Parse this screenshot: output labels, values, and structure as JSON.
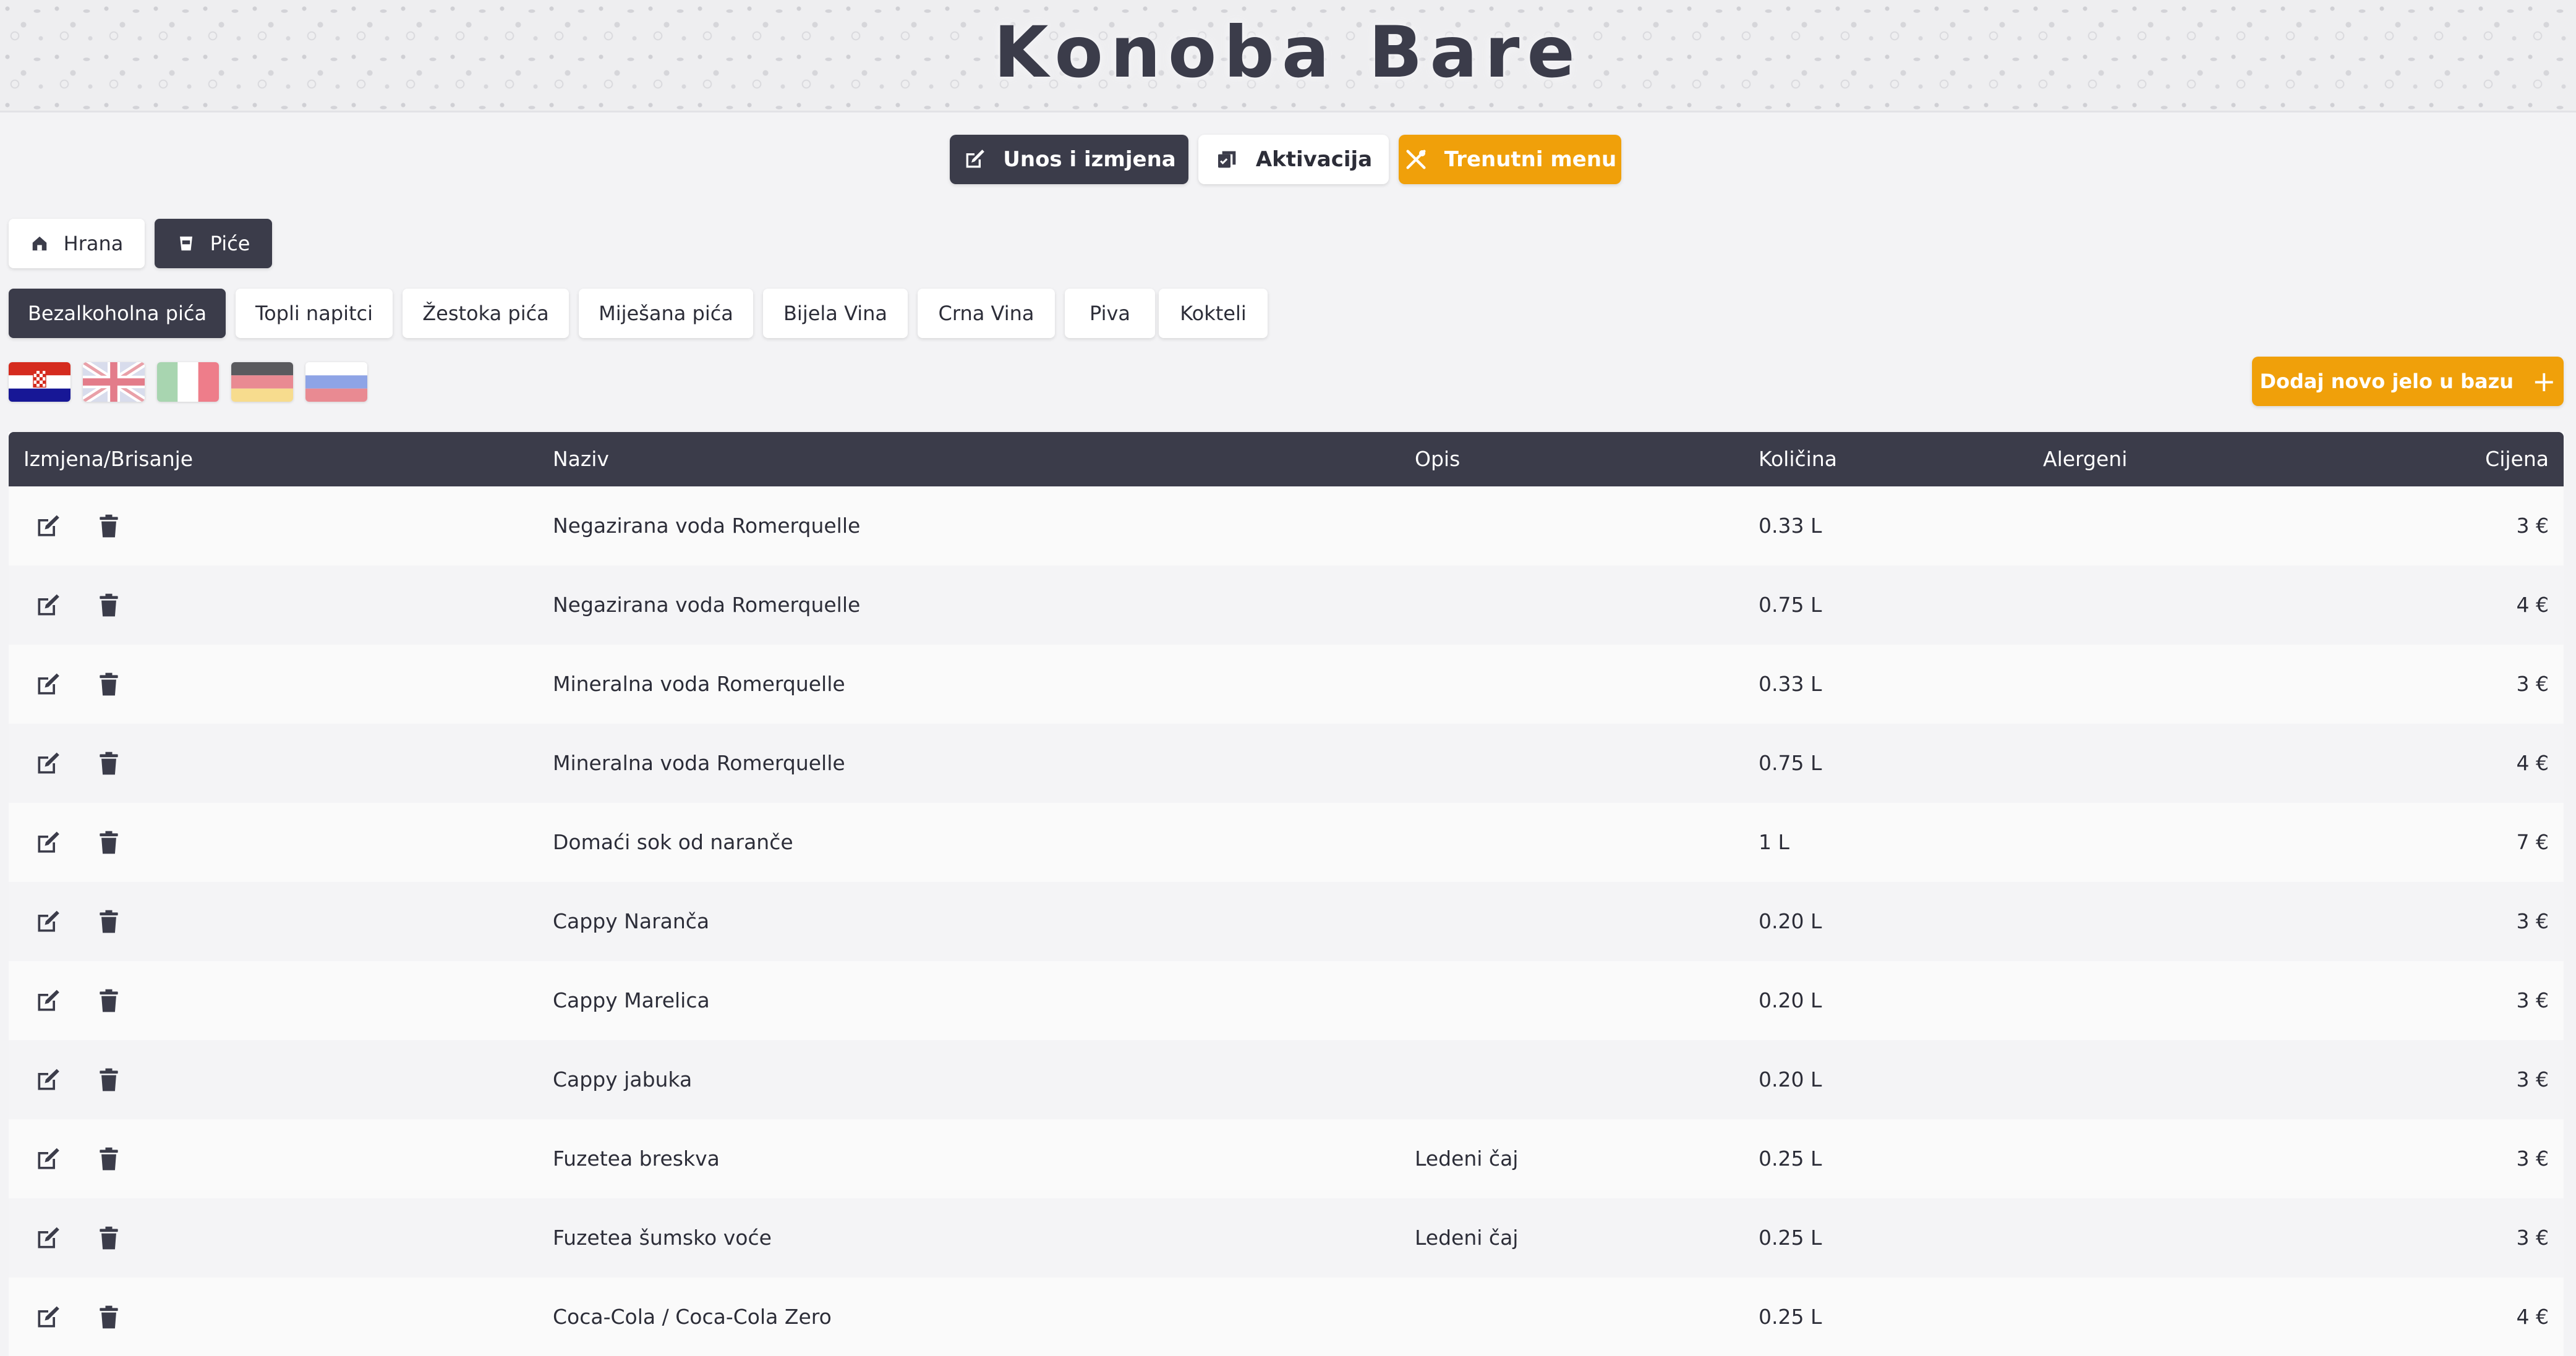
{
  "header": {
    "title": "Konoba Bare"
  },
  "nav": {
    "unos_label": "Unos i izmjena",
    "aktivacija_label": "Aktivacija",
    "trenutni_label": "Trenutni menu"
  },
  "categories": {
    "hrana_label": "Hrana",
    "pice_label": "Piće",
    "selected": "Piće"
  },
  "subcategories": {
    "selected": "Bezalkoholna pića",
    "items": [
      "Bezalkoholna pića",
      "Topli napitci",
      "Žestoka pića",
      "Miješana pića",
      "Bijela Vina",
      "Crna Vina",
      "Piva",
      "Kokteli"
    ]
  },
  "languages": [
    "hr",
    "en",
    "it",
    "de",
    "ru"
  ],
  "add_button": {
    "label": "Dodaj novo jelo u bazu"
  },
  "table": {
    "headers": {
      "actions": "Izmjena/Brisanje",
      "naziv": "Naziv",
      "opis": "Opis",
      "kolicina": "Količina",
      "alergeni": "Alergeni",
      "cijena": "Cijena"
    },
    "rows": [
      {
        "naziv": "Negazirana voda Romerquelle",
        "opis": "",
        "kolicina": "0.33 L",
        "alergeni": "",
        "cijena": "3 €"
      },
      {
        "naziv": "Negazirana voda Romerquelle",
        "opis": "",
        "kolicina": "0.75 L",
        "alergeni": "",
        "cijena": "4 €"
      },
      {
        "naziv": "Mineralna voda Romerquelle",
        "opis": "",
        "kolicina": "0.33 L",
        "alergeni": "",
        "cijena": "3 €"
      },
      {
        "naziv": "Mineralna voda Romerquelle",
        "opis": "",
        "kolicina": "0.75 L",
        "alergeni": "",
        "cijena": "4 €"
      },
      {
        "naziv": "Domaći sok od naranče",
        "opis": "",
        "kolicina": "1 L",
        "alergeni": "",
        "cijena": "7 €"
      },
      {
        "naziv": "Cappy Naranča",
        "opis": "",
        "kolicina": "0.20 L",
        "alergeni": "",
        "cijena": "3 €"
      },
      {
        "naziv": "Cappy Marelica",
        "opis": "",
        "kolicina": "0.20 L",
        "alergeni": "",
        "cijena": "3 €"
      },
      {
        "naziv": "Cappy jabuka",
        "opis": "",
        "kolicina": "0.20 L",
        "alergeni": "",
        "cijena": "3 €"
      },
      {
        "naziv": "Fuzetea breskva",
        "opis": "Ledeni čaj",
        "kolicina": "0.25 L",
        "alergeni": "",
        "cijena": "3 €"
      },
      {
        "naziv": "Fuzetea šumsko voće",
        "opis": "Ledeni čaj",
        "kolicina": "0.25 L",
        "alergeni": "",
        "cijena": "3 €"
      },
      {
        "naziv": "Coca-Cola / Coca-Cola Zero",
        "opis": "",
        "kolicina": "0.25 L",
        "alergeni": "",
        "cijena": "4 €"
      }
    ]
  },
  "colors": {
    "dark": "#3b3c4a",
    "accent": "#f0a00a",
    "background": "#f3f3f5"
  }
}
